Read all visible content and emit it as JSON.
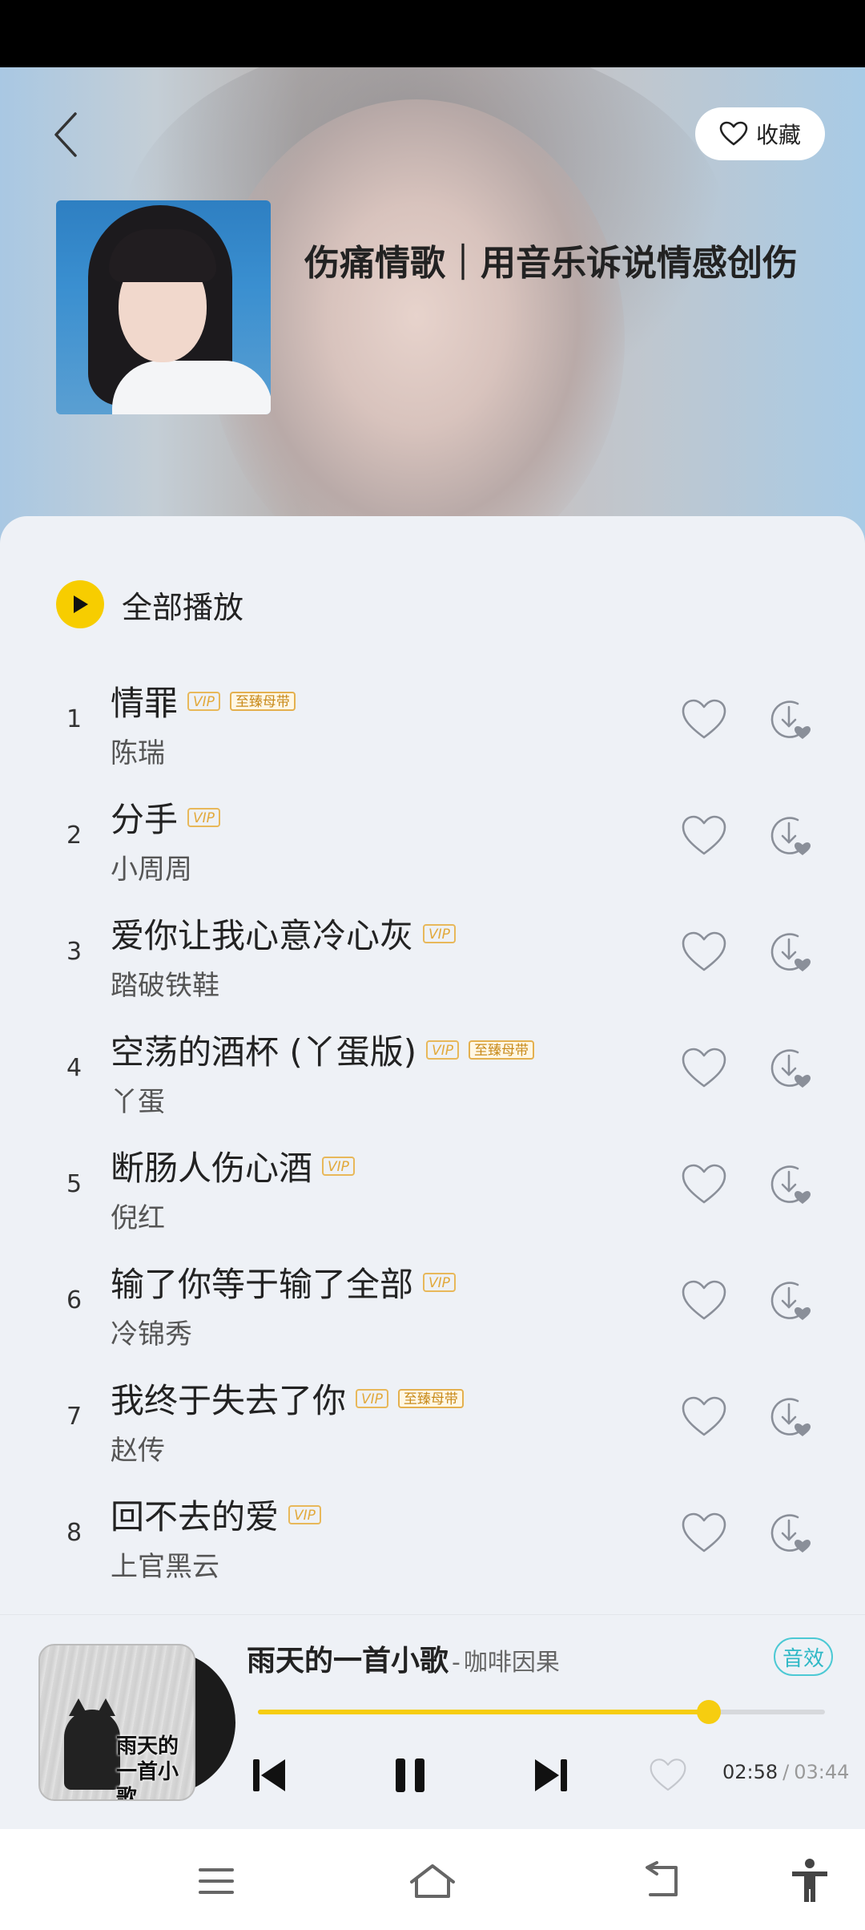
{
  "header": {
    "back_icon": "chevron-left-icon",
    "favorite_label": "收藏",
    "favorite_icon": "heart-outline-icon"
  },
  "playlist": {
    "title": "伤痛情歌｜用音乐诉说情感创伤"
  },
  "play_all": {
    "label": "全部播放",
    "icon": "play-icon"
  },
  "songs": [
    {
      "index": "1",
      "name": "情罪",
      "vip": "VIP",
      "lossless": "至臻母带",
      "artist": "陈瑞"
    },
    {
      "index": "2",
      "name": "分手",
      "vip": "VIP",
      "lossless": "",
      "artist": "小周周"
    },
    {
      "index": "3",
      "name": "爱你让我心意冷心灰",
      "vip": "VIP",
      "lossless": "",
      "artist": "踏破铁鞋"
    },
    {
      "index": "4",
      "name": "空荡的酒杯 (丫蛋版)",
      "vip": "VIP",
      "lossless": "至臻母带",
      "artist": "丫蛋"
    },
    {
      "index": "5",
      "name": "断肠人伤心酒",
      "vip": "VIP",
      "lossless": "",
      "artist": "倪红"
    },
    {
      "index": "6",
      "name": "输了你等于输了全部",
      "vip": "VIP",
      "lossless": "",
      "artist": "冷锦秀"
    },
    {
      "index": "7",
      "name": "我终于失去了你",
      "vip": "VIP",
      "lossless": "至臻母带",
      "artist": "赵传"
    },
    {
      "index": "8",
      "name": "回不去的爱",
      "vip": "VIP",
      "lossless": "",
      "artist": "上官黑云"
    }
  ],
  "player": {
    "song": "雨天的一首小歌",
    "separator": "-",
    "artist": "咖啡因果",
    "cover_text": "雨天的一首小歌",
    "effect_label": "音效",
    "progress": 0.795,
    "current_time": "02:58",
    "time_separator": "/",
    "total_time": "03:44",
    "accent_color": "#f6cd10"
  },
  "nav": {
    "icons": [
      "menu-icon",
      "home-icon",
      "back-icon",
      "accessibility-icon"
    ]
  }
}
